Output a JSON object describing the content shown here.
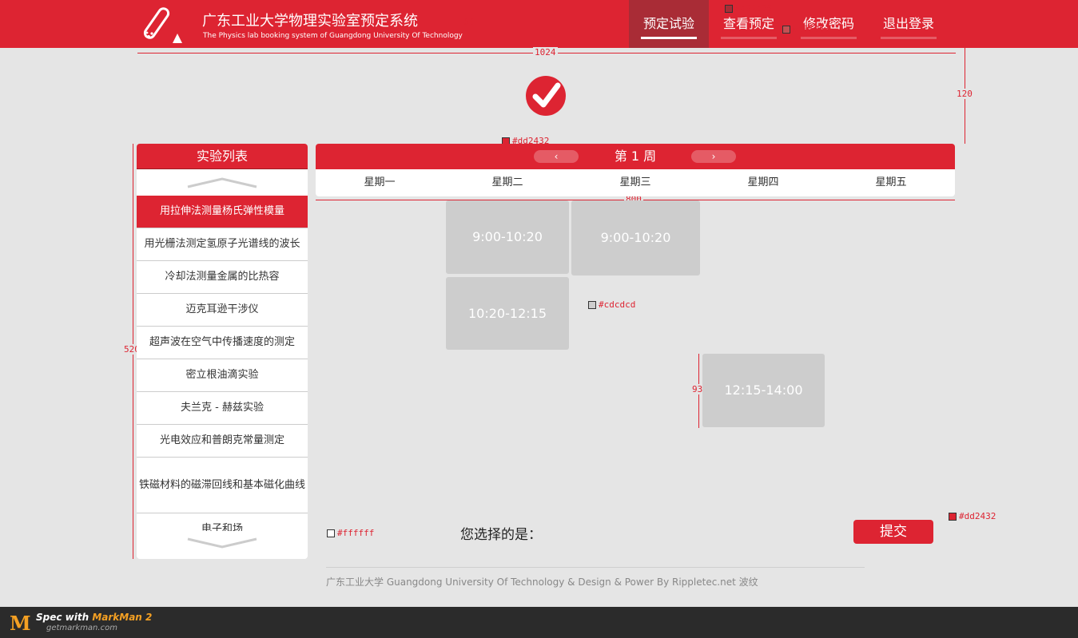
{
  "header": {
    "title_cn": "广东工业大学物理实验室预定系统",
    "title_en": "The Physics lab booking system of Guangdong University Of Technology",
    "nav": [
      {
        "label": "预定试验",
        "active": true
      },
      {
        "label": "查看预定",
        "active": false
      },
      {
        "label": "修改密码",
        "active": false
      },
      {
        "label": "退出登录",
        "active": false
      }
    ]
  },
  "annotations": {
    "header_height": "60",
    "content_width": "1024",
    "top_gap": "120",
    "sched_width": "800",
    "sidebar_height": "520",
    "slot_height": "93",
    "color_active_nav": "#a92c36",
    "color_nav_line": "#c55053",
    "color_red": "#dd2432",
    "color_border": "#9f1a24",
    "color_slot": "#cdcdcd",
    "color_white": "#ffffff",
    "color_submit": "#dd2432"
  },
  "sidebar": {
    "title": "实验列表",
    "items": [
      "用拉伸法测量杨氏弹性模量",
      "用光栅法测定氢原子光谱线的波长",
      "冷却法测量金属的比热容",
      "迈克耳逊干涉仪",
      "超声波在空气中传播速度的测定",
      "密立根油滴实验",
      "夫兰克 - 赫兹实验",
      "光电效应和普朗克常量测定",
      "铁磁材料的磁滞回线和基本磁化曲线",
      "电子和场"
    ]
  },
  "schedule": {
    "week": "第 1 周",
    "days": [
      "星期一",
      "星期二",
      "星期三",
      "星期四",
      "星期五"
    ],
    "slots": [
      "9:00-10:20",
      "9:00-10:20",
      "10:20-12:15",
      "12:15-14:00"
    ]
  },
  "selection": {
    "label": "您选择的是：",
    "submit": "提交"
  },
  "footer": {
    "text": "广东工业大学 Guangdong University Of Technology  &  Design & Power  By  Rippletec.net  波纹"
  },
  "markman": {
    "spec": "Spec with",
    "brand": "MarkMan 2",
    "url": "getmarkman.com"
  }
}
